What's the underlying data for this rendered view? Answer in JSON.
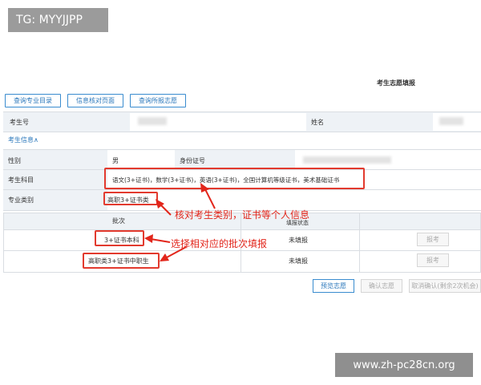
{
  "watermark_top": "TG: MYYJJPP",
  "watermark_bottom": "www.zh-pc28cn.org",
  "page_title": "考生志愿填报",
  "top_buttons": [
    "查询专业目录",
    "信息核对页面",
    "查询所报志愿"
  ],
  "candidate": {
    "id_label": "考生号",
    "name_label": "姓名"
  },
  "info_section_title": "考生信息∧",
  "info": {
    "gender_label": "性别",
    "gender_value": "男",
    "idcard_label": "身份证号",
    "subjects_label": "考生科目",
    "subjects_value": "语文(3+证书)，数学(3+证书)，英语(3+证书)，全国计算机等级证书，美术基础证书",
    "category_label": "专业类别",
    "category_value": "高职3+证书类"
  },
  "batch_table": {
    "col_batch": "批次",
    "col_status": "填报状态",
    "rows": [
      {
        "batch": "3+证书本科",
        "status": "未填报",
        "action": "报考"
      },
      {
        "batch": "高职类3+证书中职生",
        "status": "未填报",
        "action": "报考"
      }
    ]
  },
  "annotations": {
    "verify": "核对考生类别，证书等个人信息",
    "choose": "选择相对应的批次填报"
  },
  "bottom_buttons": {
    "preview": "预览志愿",
    "confirm": "确认志愿",
    "cancel": "取消确认(剩余2次机会)"
  },
  "colors": {
    "accent": "#2a77bb",
    "annotation": "#e2261b"
  }
}
